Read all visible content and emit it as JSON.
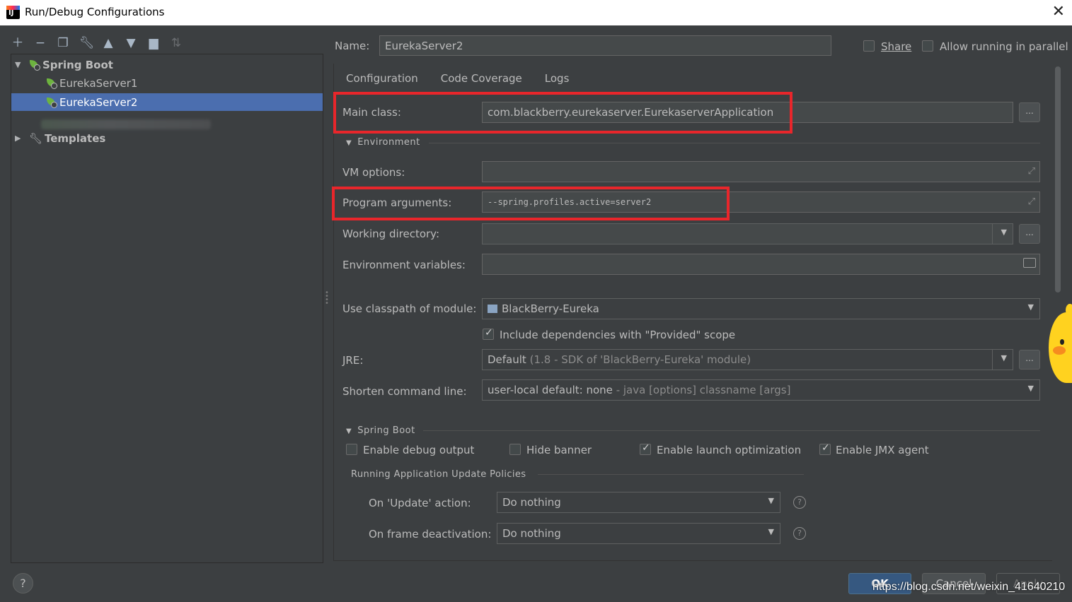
{
  "window": {
    "title": "Run/Debug Configurations"
  },
  "sidebar": {
    "toolbar_icons": [
      "add-icon",
      "remove-icon",
      "copy-icon",
      "edit-defaults-icon",
      "move-up-icon",
      "move-down-icon",
      "new-folder-icon",
      "sort-icon"
    ],
    "tree": [
      {
        "label": "Spring Boot",
        "expanded": true
      },
      {
        "label": "EurekaServer1"
      },
      {
        "label": "EurekaServer2",
        "selected": true
      },
      {
        "label": "Templates",
        "expanded": false
      }
    ]
  },
  "name_row": {
    "label": "Name:",
    "value": "EurekaServer2"
  },
  "share": {
    "label": "Share",
    "checked": false
  },
  "parallel": {
    "label": "Allow running in parallel",
    "checked": false
  },
  "tabs": [
    "Configuration",
    "Code Coverage",
    "Logs"
  ],
  "config": {
    "main_class": {
      "label": "Main class:",
      "value": "com.blackberry.eurekaserver.EurekaserverApplication"
    },
    "environment_section": "Environment",
    "vm_options": {
      "label": "VM options:",
      "value": ""
    },
    "program_arguments": {
      "label": "Program arguments:",
      "value": "--spring.profiles.active=server2"
    },
    "working_directory": {
      "label": "Working directory:",
      "value": ""
    },
    "environment_variables": {
      "label": "Environment variables:",
      "value": ""
    },
    "classpath_module": {
      "label": "Use classpath of module:",
      "value": "BlackBerry-Eureka"
    },
    "include_provided": {
      "label": "Include dependencies with \"Provided\" scope",
      "checked": true
    },
    "jre": {
      "label": "JRE:",
      "value": "Default",
      "detail": "(1.8 - SDK of 'BlackBerry-Eureka' module)"
    },
    "shorten_cmd": {
      "label": "Shorten command line:",
      "value": "user-local default: none",
      "detail": "- java [options] classname [args]"
    },
    "spring_boot_section": "Spring Boot",
    "enable_debug_output": {
      "label": "Enable debug output",
      "checked": false
    },
    "hide_banner": {
      "label": "Hide banner",
      "checked": false
    },
    "enable_launch_opt": {
      "label": "Enable launch optimization",
      "checked": true
    },
    "enable_jmx": {
      "label": "Enable JMX agent",
      "checked": true
    },
    "update_policies_title": "Running Application Update Policies",
    "on_update": {
      "label": "On 'Update' action:",
      "value": "Do nothing"
    },
    "on_frame_deactivation": {
      "label": "On frame deactivation:",
      "value": "Do nothing"
    }
  },
  "buttons": {
    "ok": "OK",
    "cancel": "Cancel",
    "apply": "Apply",
    "help": "?"
  },
  "watermark": "https://blog.csdn.net/weixin_41640210",
  "colors": {
    "selection": "#4b6eaf",
    "highlight_box": "#e8262b",
    "spring_leaf": "#6db33f"
  }
}
